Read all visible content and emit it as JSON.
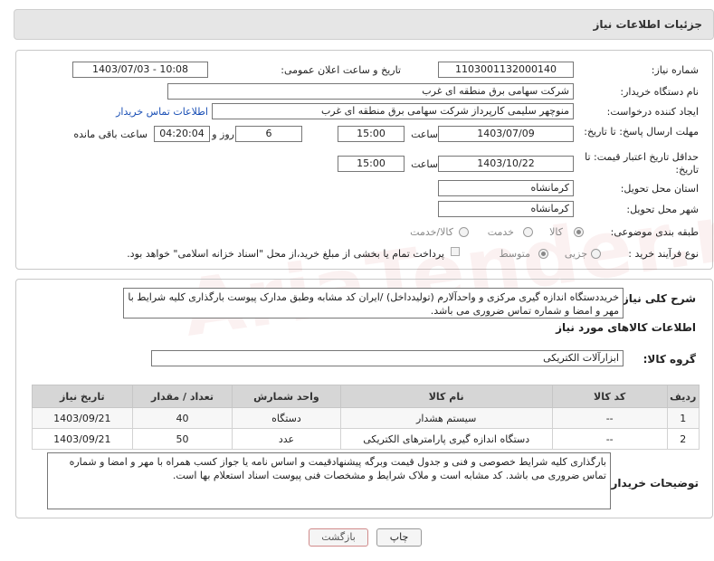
{
  "header": {
    "title": "جزئیات اطلاعات نیاز"
  },
  "form": {
    "need_number_label": "شماره نیاز:",
    "need_number": "1103001132000140",
    "announce_label": "تاریخ و ساعت اعلان عمومی:",
    "announce_value": "1403/07/03 - 10:08",
    "buyer_org_label": "نام دستگاه خریدار:",
    "buyer_org": "شرکت سهامی برق منطقه ای غرب",
    "requester_label": "ایجاد کننده درخواست:",
    "requester": "منوچهر  سلیمی کارپرداز شرکت سهامی برق منطقه ای غرب",
    "contact_link": "اطلاعات تماس خریدار",
    "deadline_label": "مهلت ارسال پاسخ: تا تاریخ:",
    "deadline_date": "1403/07/09",
    "time_label": "ساعت",
    "deadline_time": "15:00",
    "days_value": "6",
    "days_label": "روز و",
    "remaining_time": "04:20:04",
    "remaining_label": "ساعت باقی مانده",
    "validity_label": "حداقل تاریخ اعتبار قیمت: تا تاریخ:",
    "validity_date": "1403/10/22",
    "validity_time": "15:00",
    "province_label": "استان محل تحویل:",
    "province": "کرمانشاه",
    "city_label": "شهر محل تحویل:",
    "city": "کرمانشاه",
    "category_label": "طبقه بندی موضوعی:",
    "category_options": [
      "کالا",
      "خدمت",
      "کالا/خدمت"
    ],
    "process_label": "نوع فرآیند خرید :",
    "process_options": [
      "جزیی",
      "متوسط"
    ],
    "payment_note": "پرداخت تمام یا بخشی از مبلغ خرید،از محل \"اسناد خزانه اسلامی\" خواهد بود."
  },
  "description": {
    "label": "شرح کلی نیاز:",
    "text": "خریددستگاه اندازه گیری مرکزی و واحدآلارم (تولیدداخل) /ایران کد مشابه وطبق مدارک پیوست بارگذاری کلیه شرایط با مهر و امضا و شماره تماس ضروری می باشد."
  },
  "goods": {
    "section_title": "اطلاعات کالاهای مورد نیاز",
    "group_label": "گروه کالا:",
    "group_value": "ابزارآلات الکتریکی",
    "columns": [
      "ردیف",
      "کد کالا",
      "نام کالا",
      "واحد شمارش",
      "تعداد / مقدار",
      "تاریخ نیاز"
    ],
    "rows": [
      [
        "1",
        "--",
        "سیستم هشدار",
        "دستگاه",
        "40",
        "1403/09/21"
      ],
      [
        "2",
        "--",
        "دستگاه اندازه گیری پارامترهای الکتریکی",
        "عدد",
        "50",
        "1403/09/21"
      ]
    ]
  },
  "buyer_notes": {
    "label": "توضیحات خریدار:",
    "text": "بارگذاری کلیه شرایط خصوصی و فنی و جدول قیمت وبرگه پیشنهادقیمت و اساس نامه یا جواز کسب همراه با مهر و امضا و شماره تماس ضروری می باشد. کد مشابه است و ملاک شرایط و مشخصات فنی پیوست اسناد استعلام بها است."
  },
  "buttons": {
    "print": "چاپ",
    "back": "بازگشت"
  },
  "watermark": "AriaTender.neT"
}
